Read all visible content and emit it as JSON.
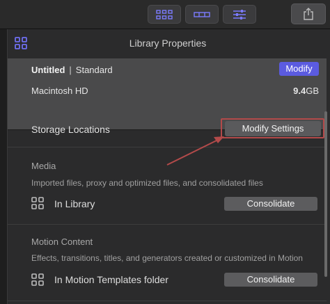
{
  "toolbar": {
    "buttons": [
      {
        "icon": "library-grid-icon"
      },
      {
        "icon": "browser-filmstrip-icon"
      },
      {
        "icon": "inspector-sliders-icon"
      }
    ],
    "share_icon": "share-icon"
  },
  "panel": {
    "title": "Library Properties",
    "header_icon": "library-icon"
  },
  "library": {
    "name": "Untitled",
    "separator": "|",
    "mode": "Standard",
    "modify_label": "Modify",
    "volume": "Macintosh HD",
    "size_value": "9.4",
    "size_unit": "GB"
  },
  "storage": {
    "title": "Storage Locations",
    "modify_settings_label": "Modify Settings"
  },
  "media": {
    "title": "Media",
    "description": "Imported files, proxy and optimized files, and consolidated files",
    "location": "In Library",
    "consolidate_label": "Consolidate"
  },
  "motion": {
    "title": "Motion Content",
    "description": "Effects, transitions, titles, and generators created or customized in Motion",
    "location": "In Motion Templates folder",
    "consolidate_label": "Consolidate"
  },
  "colors": {
    "accent": "#5b5be0",
    "highlight": "#b34a4a",
    "panel": "#2b2b2c",
    "summary": "#4a4a4b"
  }
}
